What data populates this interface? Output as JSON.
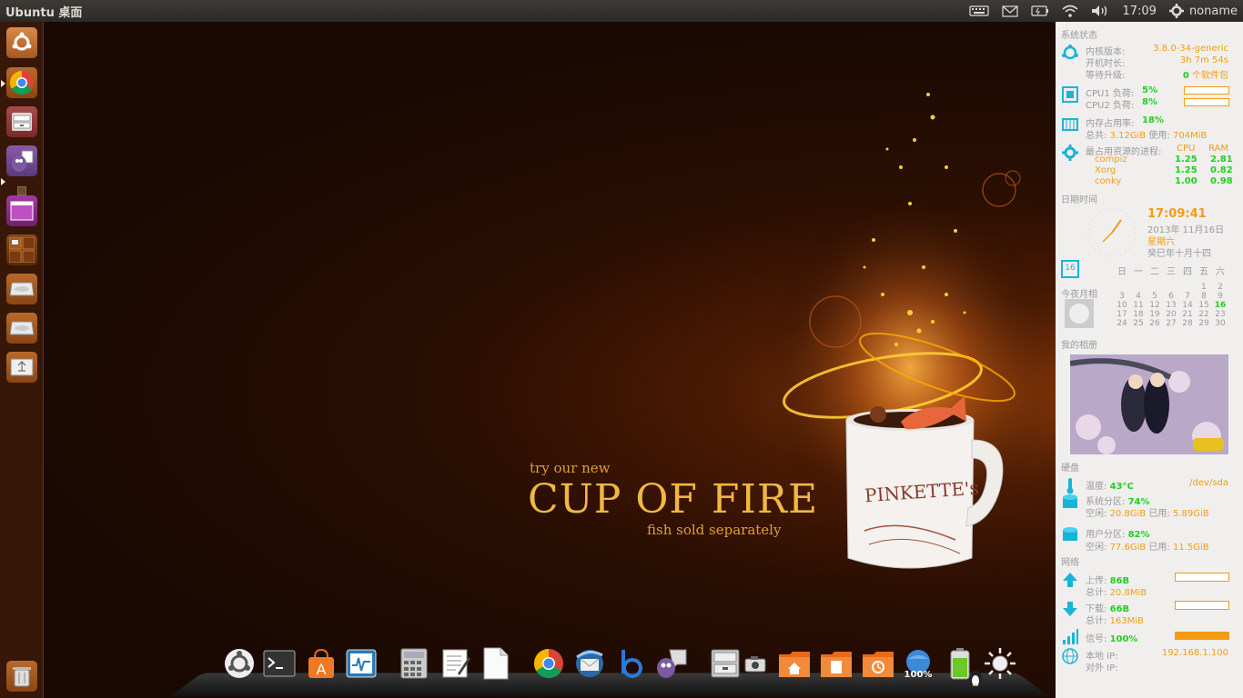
{
  "panel": {
    "title": "Ubuntu 桌面",
    "time": "17:09",
    "user": "noname"
  },
  "launcher": {
    "items": [
      "ubuntu-home",
      "chrome",
      "file-manager",
      "pidgin",
      "workspace-switcher-purple",
      "workspace-switcher",
      "disk-1",
      "disk-2",
      "usb-drive",
      "trash"
    ]
  },
  "wallpaper": {
    "line1": "try our new",
    "line2": "CUP OF FIRE",
    "line3": "fish sold separately",
    "mug_text": "PINKETTE's"
  },
  "conky": {
    "system": {
      "heading": "系统状态",
      "kernel_label": "内核版本:",
      "kernel_value": "3.8.0-34-generic",
      "uptime_label": "开机时长:",
      "uptime_value": "3h 7m 54s",
      "upgrade_label": "等待升级:",
      "upgrade_count": "0",
      "upgrade_suffix": "个软件包"
    },
    "cpu": {
      "cpu1_label": "CPU1 负荷:",
      "cpu1_value": "5%",
      "cpu2_label": "CPU2 负荷:",
      "cpu2_value": "8%"
    },
    "memory": {
      "usage_label": "内存占用率:",
      "usage_value": "18%",
      "total_label": "总共:",
      "total_value": "3.12GiB",
      "used_label": "使用:",
      "used_value": "704MiB"
    },
    "processes": {
      "heading": "最占用资源的进程:",
      "col_cpu": "CPU",
      "col_ram": "RAM",
      "rows": [
        {
          "name": "compiz",
          "cpu": "1.25",
          "ram": "2.81"
        },
        {
          "name": "Xorg",
          "cpu": "1.25",
          "ram": "0.82"
        },
        {
          "name": "conky",
          "cpu": "1.00",
          "ram": "0.98"
        }
      ]
    },
    "datetime": {
      "heading": "日期时间",
      "clock": "17:09:41",
      "date": "2013年 11月16日",
      "weekday": "星期六",
      "lunar": "癸巳年十月十四"
    },
    "calendar": {
      "icon_day": "16",
      "headers": [
        "日",
        "一",
        "二",
        "三",
        "四",
        "五",
        "六"
      ],
      "weeks": [
        [
          "",
          "",
          "",
          "",
          "",
          "1",
          "2"
        ],
        [
          "3",
          "4",
          "5",
          "6",
          "7",
          "8",
          "9"
        ],
        [
          "10",
          "11",
          "12",
          "13",
          "14",
          "15",
          "16"
        ],
        [
          "17",
          "18",
          "19",
          "20",
          "21",
          "22",
          "23"
        ],
        [
          "24",
          "25",
          "26",
          "27",
          "28",
          "29",
          "30"
        ]
      ],
      "today": "16",
      "moon_label": "今夜月相"
    },
    "album": {
      "heading": "我的相册"
    },
    "disk": {
      "heading": "硬盘",
      "temp_label": "温度:",
      "temp_value": "43°C",
      "device": "/dev/sda",
      "sys_label": "系统分区:",
      "sys_value": "74%",
      "sys_free_label": "空闲:",
      "sys_free": "20.8GiB",
      "sys_used_label": "已用:",
      "sys_used": "5.89GiB",
      "user_label": "用户分区:",
      "user_value": "82%",
      "user_free_label": "空闲:",
      "user_free": "77.6GiB",
      "user_used_label": "已用:",
      "user_used": "11.5GiB"
    },
    "network": {
      "heading": "网络",
      "up_label": "上传:",
      "up_value": "86B",
      "up_total_label": "总计:",
      "up_total": "20.8MiB",
      "down_label": "下载:",
      "down_value": "66B",
      "down_total_label": "总计:",
      "down_total": "163MiB",
      "signal_label": "信号:",
      "signal_value": "100%",
      "signal_level": 1.0,
      "local_ip_label": "本地 IP:",
      "local_ip": "192.168.1.100",
      "ext_ip_label": "对外 IP:"
    }
  },
  "dock": {
    "items": [
      "ubuntu",
      "terminal",
      "software-center",
      "system-monitor",
      "calculator",
      "text-editor",
      "document",
      "chrome",
      "thunderbird",
      "bluefish",
      "pidgin",
      "file-cabinet",
      "screenshot",
      "home-folder",
      "documents-folder",
      "backup-folder",
      "network-globe",
      "battery",
      "brightness"
    ],
    "network_label": "100%"
  },
  "colors": {
    "accent_orange": "#f39c12",
    "value_green": "#1fd11f",
    "conky_icon": "#18b4d8"
  }
}
